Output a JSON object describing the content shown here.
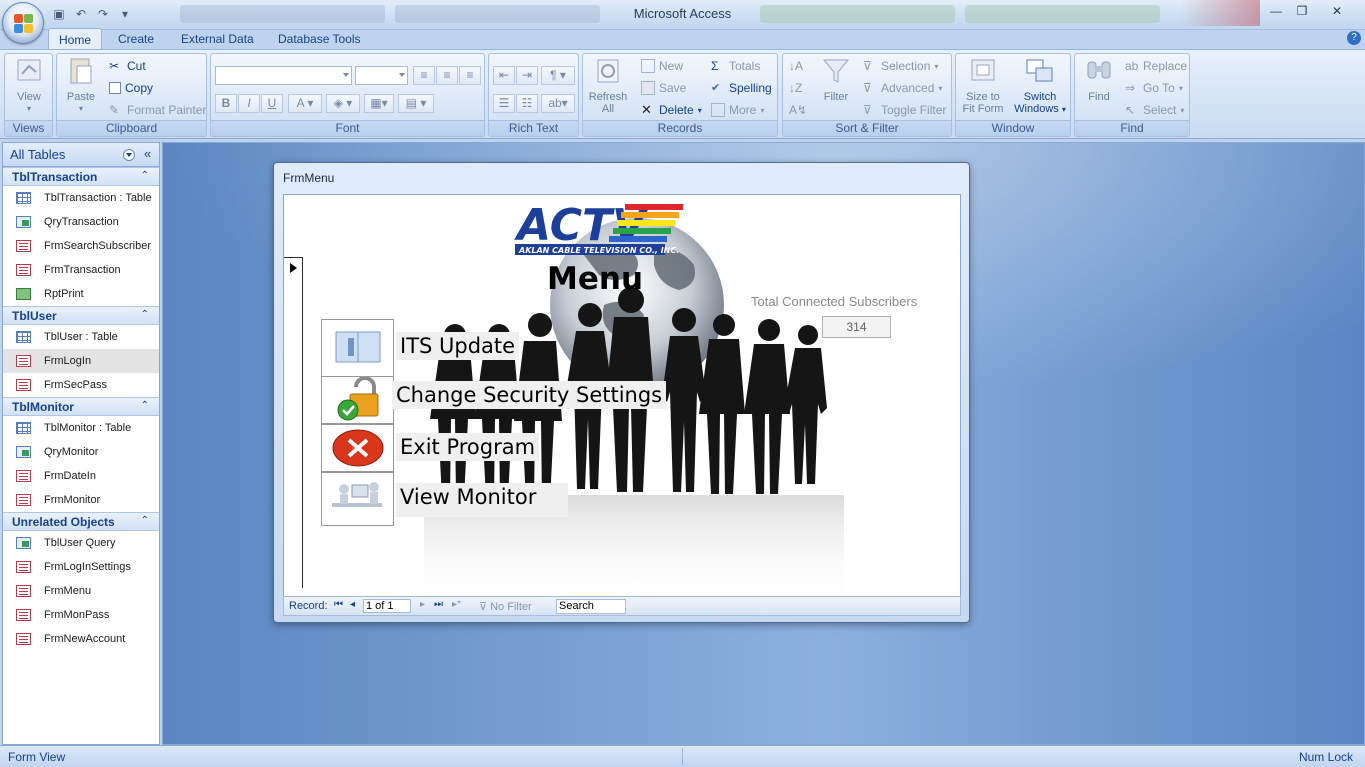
{
  "window": {
    "title": "Microsoft Access",
    "controls": [
      "—",
      "❐",
      "✕"
    ]
  },
  "ribbon": {
    "tabs": [
      "Home",
      "Create",
      "External Data",
      "Database Tools"
    ],
    "active_tab": "Home",
    "groups": {
      "views": {
        "label": "Views",
        "view": "View"
      },
      "clipboard": {
        "label": "Clipboard",
        "paste": "Paste",
        "cut": "Cut",
        "copy": "Copy",
        "format_painter": "Format Painter"
      },
      "font": {
        "label": "Font"
      },
      "rich_text": {
        "label": "Rich Text"
      },
      "records": {
        "label": "Records",
        "refresh": "Refresh",
        "refresh2": "All",
        "new": "New",
        "save": "Save",
        "delete": "Delete",
        "totals": "Totals",
        "spelling": "Spelling",
        "more": "More"
      },
      "sort_filter": {
        "label": "Sort & Filter",
        "filter": "Filter",
        "selection": "Selection",
        "advanced": "Advanced",
        "toggle_filter": "Toggle Filter"
      },
      "window": {
        "label": "Window",
        "size_to": "Size to",
        "fit_form": "Fit Form",
        "switch": "Switch",
        "windows": "Windows"
      },
      "find": {
        "label": "Find",
        "find": "Find",
        "replace": "Replace",
        "goto": "Go To",
        "select": "Select"
      }
    }
  },
  "nav": {
    "header": "All Tables",
    "groups": [
      {
        "name": "TblTransaction",
        "items": [
          {
            "icon": "table",
            "label": "TblTransaction : Table"
          },
          {
            "icon": "query",
            "label": "QryTransaction"
          },
          {
            "icon": "form",
            "label": "FrmSearchSubscriber"
          },
          {
            "icon": "form",
            "label": "FrmTransaction"
          },
          {
            "icon": "report",
            "label": "RptPrint"
          }
        ]
      },
      {
        "name": "TblUser",
        "items": [
          {
            "icon": "table",
            "label": "TblUser : Table"
          },
          {
            "icon": "form",
            "label": "FrmLogIn",
            "selected": true
          },
          {
            "icon": "form",
            "label": "FrmSecPass"
          }
        ]
      },
      {
        "name": "TblMonitor",
        "items": [
          {
            "icon": "table",
            "label": "TblMonitor : Table"
          },
          {
            "icon": "query",
            "label": "QryMonitor"
          },
          {
            "icon": "form",
            "label": "FrmDateIn"
          },
          {
            "icon": "form",
            "label": "FrmMonitor"
          }
        ]
      },
      {
        "name": "Unrelated Objects",
        "items": [
          {
            "icon": "query",
            "label": "TblUser Query"
          },
          {
            "icon": "form",
            "label": "FrmLogInSettings"
          },
          {
            "icon": "form",
            "label": "FrmMenu"
          },
          {
            "icon": "form",
            "label": "FrmMonPass"
          },
          {
            "icon": "form",
            "label": "FrmNewAccount"
          }
        ]
      }
    ]
  },
  "form": {
    "window_title": "FrmMenu",
    "logo_text": "ACTV",
    "logo_subtext": "AKLAN CABLE TELEVISION CO., INC.",
    "menu_title": "Menu",
    "subscribers_label": "Total Connected Subscribers",
    "subscribers_value": "314",
    "buttons": {
      "its_update": "ITS Update",
      "security": "Change Security Settings",
      "exit": "Exit Program",
      "monitor": "View Monitor"
    },
    "record_nav": {
      "label": "Record:",
      "position": "1 of 1",
      "no_filter": "No Filter",
      "search": "Search"
    }
  },
  "status": {
    "left": "Form View",
    "right": "Num Lock"
  }
}
